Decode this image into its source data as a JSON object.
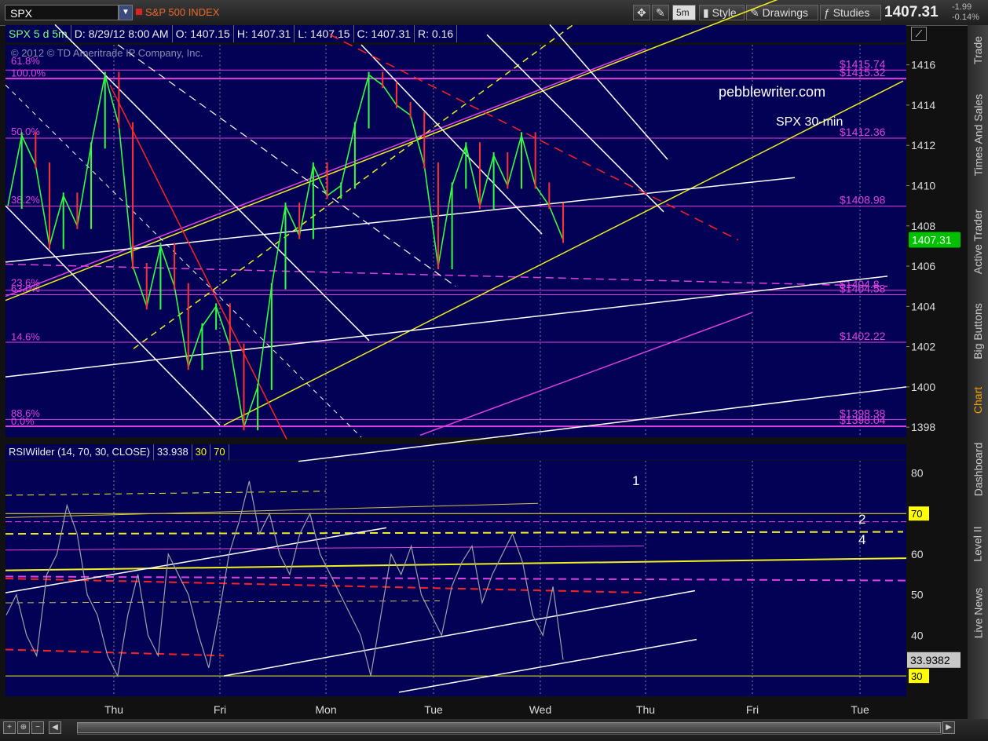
{
  "toolbar": {
    "symbol": "SPX",
    "index_name": "S&P 500 INDEX",
    "interval": "5m",
    "style_label": "Style",
    "drawings_label": "Drawings",
    "studies_label": "Studies",
    "last": "1407.31",
    "change": "-1.99",
    "change_pct": "-0.14%"
  },
  "sidebar_tabs": [
    "Trade",
    "Times And Sales",
    "Active Trader",
    "Big Buttons",
    "Chart",
    "Dashboard",
    "Level II",
    "Live News"
  ],
  "info_bar": {
    "title": "SPX 5 d 5m",
    "date": "D: 8/29/12 8:00 AM",
    "open": "O: 1407.15",
    "high": "H: 1407.31",
    "low": "L: 1407.15",
    "close": "C: 1407.31",
    "range": "R: 0.16"
  },
  "rsi_header": {
    "study": "RSIWilder (14, 70, 30, CLOSE)",
    "value": "33.938",
    "ob": "30",
    "os": "70"
  },
  "copyright": "© 2012 © TD Ameritrade IP Company, Inc.",
  "watermark": {
    "site": "pebblewriter.com",
    "subtitle": "SPX 30-min"
  },
  "colors": {
    "background": "#020155",
    "fib": "#e040e0",
    "channel_yellow": "#f0f020",
    "red": "#ff2020",
    "white": "#ffffff"
  },
  "chart_data": [
    {
      "type": "line",
      "name": "SPX price",
      "x_labels": [
        "Thu",
        "Fri",
        "Mon",
        "Tue",
        "Wed",
        "Thu",
        "Fri",
        "Tue"
      ],
      "ylim": [
        1397.5,
        1417
      ],
      "y_ticks": [
        1398,
        1400,
        1402,
        1404,
        1406,
        1408,
        1410,
        1412,
        1414,
        1416
      ],
      "last_price": 1407.31,
      "levels": [
        {
          "label": "$1415.74",
          "value": 1415.74
        },
        {
          "label": "$1415.32",
          "value": 1415.32
        },
        {
          "label": "$1412.36",
          "value": 1412.36
        },
        {
          "label": "$1408.98",
          "value": 1408.98
        },
        {
          "label": "$1404.8",
          "value": 1404.8
        },
        {
          "label": "$1404.58",
          "value": 1404.58
        },
        {
          "label": "$1402.22",
          "value": 1402.22
        },
        {
          "label": "$1398.38",
          "value": 1398.38
        },
        {
          "label": "$1398.04",
          "value": 1398.04
        }
      ],
      "fib_labels": [
        "61.8%",
        "100.0%",
        "50.0%",
        "38.2%",
        "23.6%",
        "63.0%",
        "14.6%",
        "88.6%",
        "0.0%"
      ],
      "close_path": [
        1409,
        1412.5,
        1411,
        1407,
        1409.5,
        1408,
        1412,
        1415.5,
        1413,
        1406,
        1404,
        1407,
        1405,
        1401,
        1403,
        1404,
        1402,
        1398,
        1400,
        1405,
        1409,
        1407.5,
        1411,
        1409.5,
        1410,
        1413,
        1415.5,
        1415,
        1414,
        1413.5,
        1411,
        1406,
        1410,
        1412,
        1409,
        1411.5,
        1410,
        1412.5,
        1410,
        1409,
        1407.31
      ]
    },
    {
      "type": "line",
      "name": "RSIWilder",
      "ylim": [
        25,
        83
      ],
      "y_ticks": [
        30,
        40,
        50,
        60,
        70,
        80
      ],
      "overbought": 70,
      "oversold": 30,
      "last_value": 33.9382,
      "annotations": [
        "1",
        "2",
        "4"
      ],
      "values": [
        45,
        50,
        40,
        35,
        55,
        60,
        72,
        65,
        50,
        45,
        35,
        30,
        45,
        55,
        40,
        35,
        60,
        55,
        50,
        40,
        32,
        45,
        60,
        68,
        78,
        65,
        70,
        60,
        55,
        65,
        70,
        60,
        55,
        50,
        45,
        40,
        30,
        45,
        60,
        55,
        62,
        50,
        45,
        40,
        52,
        58,
        62,
        48,
        55,
        60,
        65,
        58,
        45,
        40,
        52,
        34
      ]
    }
  ]
}
